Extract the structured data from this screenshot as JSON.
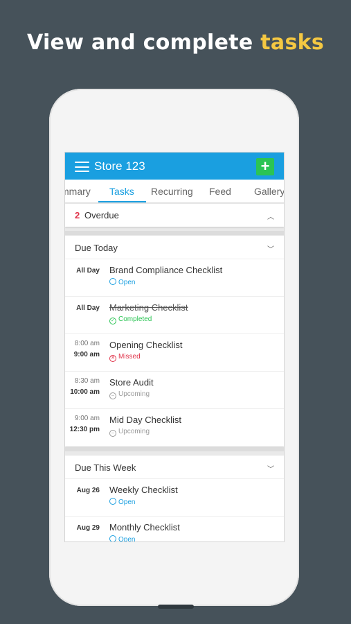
{
  "headline": {
    "prefix": "View and complete",
    "accent": "tasks"
  },
  "colors": {
    "background": "#46525a",
    "accent": "#f5c842",
    "appbar": "#1a9fe0",
    "add": "#2bc454",
    "open": "#1a9fe0",
    "completed": "#2bc454",
    "missed": "#e0334a",
    "upcoming": "#9a9a9a"
  },
  "appbar": {
    "title": "Store 123",
    "menu_icon": "hamburger-icon",
    "add_icon": "plus-icon",
    "add_label": "+"
  },
  "tabs": [
    {
      "label": "mmary"
    },
    {
      "label": "Tasks",
      "active": true
    },
    {
      "label": "Recurring"
    },
    {
      "label": "Feed"
    },
    {
      "label": "Gallery"
    }
  ],
  "overdue": {
    "count": "2",
    "label": "Overdue"
  },
  "due_today": {
    "title": "Due Today",
    "tasks": [
      {
        "time": "All Day",
        "name": "Brand Compliance Checklist",
        "status": "Open"
      },
      {
        "time": "All Day",
        "name": "Marketing Checklist",
        "status": "Completed"
      },
      {
        "start": "8:00 am",
        "end": "9:00 am",
        "name": "Opening Checklist",
        "status": "Missed"
      },
      {
        "start": "8:30 am",
        "end": "10:00 am",
        "name": "Store Audit",
        "status": "Upcoming"
      },
      {
        "start": "9:00 am",
        "end": "12:30 pm",
        "name": "Mid Day Checklist",
        "status": "Upcoming"
      }
    ]
  },
  "due_week": {
    "title": "Due This Week",
    "tasks": [
      {
        "time": "Aug 26",
        "name": "Weekly Checklist",
        "status": "Open"
      },
      {
        "time": "Aug 29",
        "name": "Monthly Checklist",
        "status": "Open"
      }
    ]
  }
}
